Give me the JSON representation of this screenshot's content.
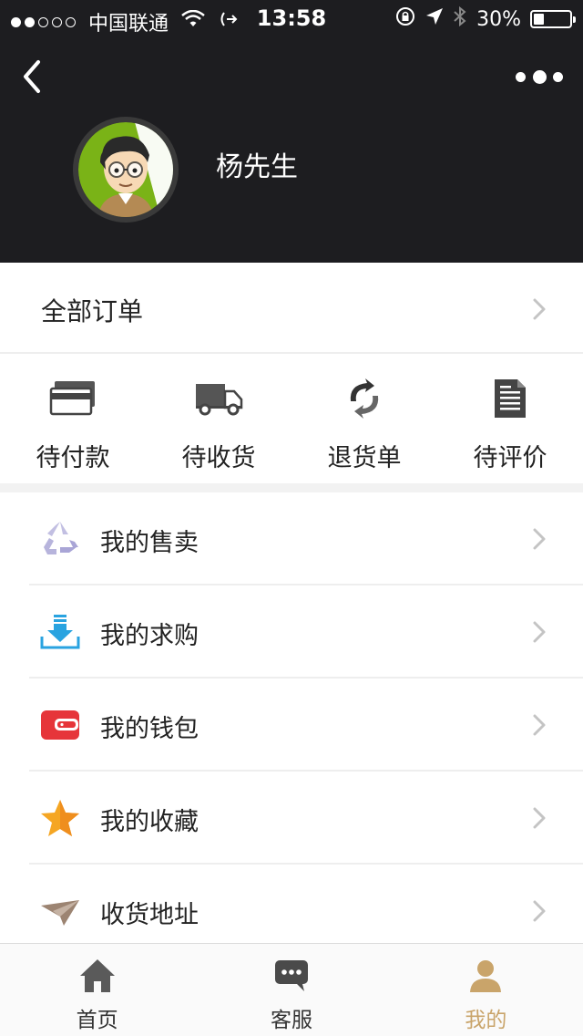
{
  "status_bar": {
    "carrier": "中国联通",
    "time": "13:58",
    "battery": "30%",
    "battery_level": 0.3
  },
  "header": {
    "user_name": "杨先生",
    "background_color": "#1d1d20",
    "icons": {
      "back": "chevron-left-icon",
      "more": "more-dots-icon"
    }
  },
  "orders": {
    "all_label": "全部订单",
    "statuses": [
      {
        "label": "待付款",
        "icon": "credit-card-icon"
      },
      {
        "label": "待收货",
        "icon": "delivery-truck-icon"
      },
      {
        "label": "退货单",
        "icon": "refresh-return-icon"
      },
      {
        "label": "待评价",
        "icon": "document-review-icon"
      }
    ]
  },
  "menu": [
    {
      "label": "我的售卖",
      "icon": "recycle-icon",
      "color": "#b7b4dc"
    },
    {
      "label": "我的求购",
      "icon": "download-tray-icon",
      "color": "#29a3e0"
    },
    {
      "label": "我的钱包",
      "icon": "wallet-icon",
      "color": "#e6353a"
    },
    {
      "label": "我的收藏",
      "icon": "star-icon",
      "color": "#f5a623"
    },
    {
      "label": "收货地址",
      "icon": "paper-plane-icon",
      "color": "#9c8472"
    }
  ],
  "tabbar": {
    "items": [
      {
        "label": "首页",
        "icon": "home-icon"
      },
      {
        "label": "客服",
        "icon": "chat-bubble-icon"
      },
      {
        "label": "我的",
        "icon": "user-icon"
      }
    ],
    "active_index": 2,
    "accent_color": "#c9a46a"
  }
}
